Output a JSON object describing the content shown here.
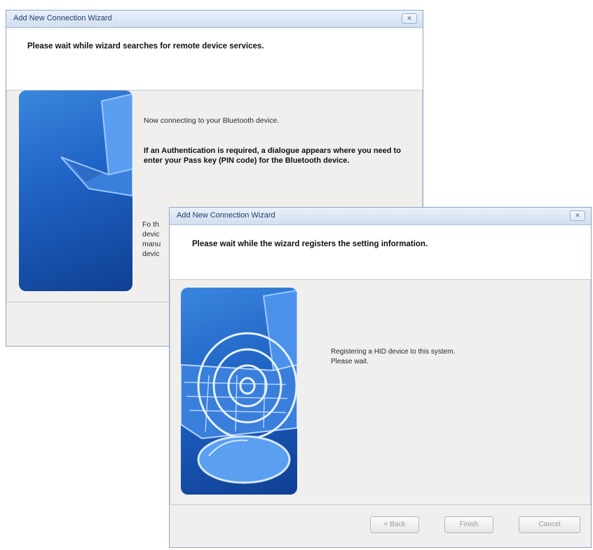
{
  "back_window": {
    "title": "Add New Connection Wizard",
    "close_glyph": "✕",
    "header": "Please wait while wizard searches for remote device services.",
    "line1": "Now connecting to your Bluetooth device.",
    "bold_text": "If an Authentication is required, a dialogue appears where you need to enter your Pass key (PIN code) for the Bluetooth device.",
    "partial_lines": [
      "Fo th",
      "devic",
      "manu",
      "devic"
    ]
  },
  "front_window": {
    "title": "Add New Connection Wizard",
    "close_glyph": "✕",
    "header": "Please wait while the wizard registers the setting information.",
    "status_line1": "Registering a HID device to this system.",
    "status_line2": "Please wait.",
    "buttons": {
      "back": "< Back",
      "finish": "Finish",
      "cancel": "Cancel"
    }
  },
  "colors": {
    "art_blue": "#1f62c4",
    "title_text": "#1e3d6e"
  }
}
